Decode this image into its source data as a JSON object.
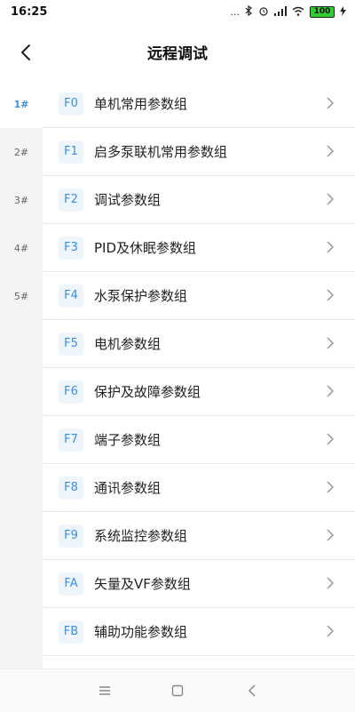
{
  "status": {
    "time": "16:25",
    "dots": "...",
    "battery": "100"
  },
  "header": {
    "title": "远程调试"
  },
  "rail": {
    "items": [
      {
        "label": "1#"
      },
      {
        "label": "2#"
      },
      {
        "label": "3#"
      },
      {
        "label": "4#"
      },
      {
        "label": "5#"
      }
    ]
  },
  "list": {
    "items": [
      {
        "code": "F0",
        "label": "单机常用参数组"
      },
      {
        "code": "F1",
        "label": "启多泵联机常用参数组"
      },
      {
        "code": "F2",
        "label": "调试参数组"
      },
      {
        "code": "F3",
        "label": "PID及休眠参数组"
      },
      {
        "code": "F4",
        "label": "水泵保护参数组"
      },
      {
        "code": "F5",
        "label": "电机参数组"
      },
      {
        "code": "F6",
        "label": "保护及故障参数组"
      },
      {
        "code": "F7",
        "label": "端子参数组"
      },
      {
        "code": "F8",
        "label": "通讯参数组"
      },
      {
        "code": "F9",
        "label": "系统监控参数组"
      },
      {
        "code": "FA",
        "label": "矢量及VF参数组"
      },
      {
        "code": "FB",
        "label": "辅助功能参数组"
      }
    ]
  },
  "colors": {
    "accent": "#3a8ee6",
    "rail_bg": "#f2f3f5"
  }
}
